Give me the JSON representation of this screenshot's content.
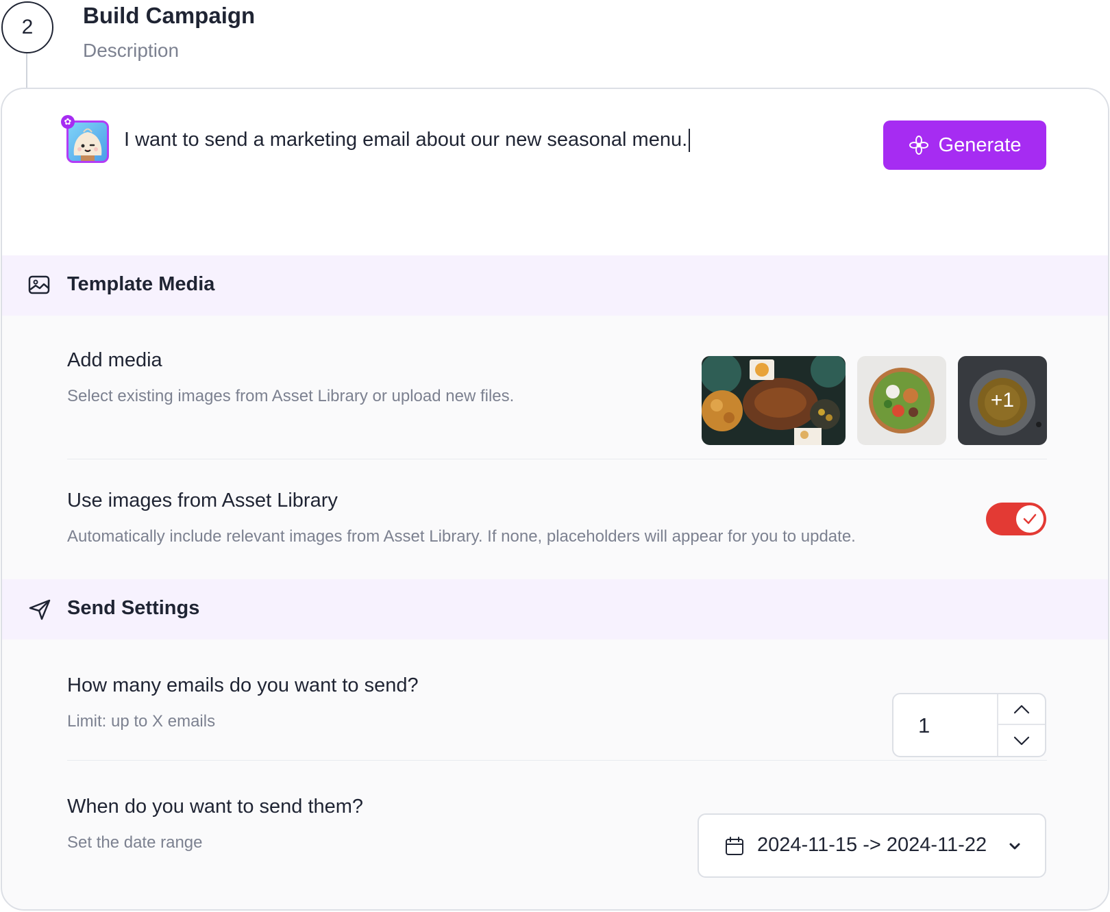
{
  "step": {
    "number": "2",
    "title": "Build Campaign",
    "description": "Description"
  },
  "prompt": {
    "text": "I want to send a marketing email about our new seasonal menu.",
    "generate_label": "Generate"
  },
  "template_media": {
    "header": "Template Media",
    "add_media": {
      "title": "Add media",
      "subtitle": "Select existing images from Asset Library or upload new files.",
      "more_count": "+1"
    },
    "asset_library": {
      "title": "Use images from Asset Library",
      "subtitle": "Automatically include relevant images from Asset Library. If none, placeholders will appear for you to update.",
      "enabled": true
    }
  },
  "send_settings": {
    "header": "Send Settings",
    "count": {
      "title": "How many emails do you want to send?",
      "subtitle": "Limit: up to X emails",
      "value": "1"
    },
    "schedule": {
      "title": "When do you want to send them?",
      "subtitle": "Set the date range",
      "value": "2024-11-15 -> 2024-11-22"
    }
  },
  "colors": {
    "accent": "#a62cf2",
    "toggle_on": "#e33a34",
    "section_bg": "#f7f2fe"
  }
}
